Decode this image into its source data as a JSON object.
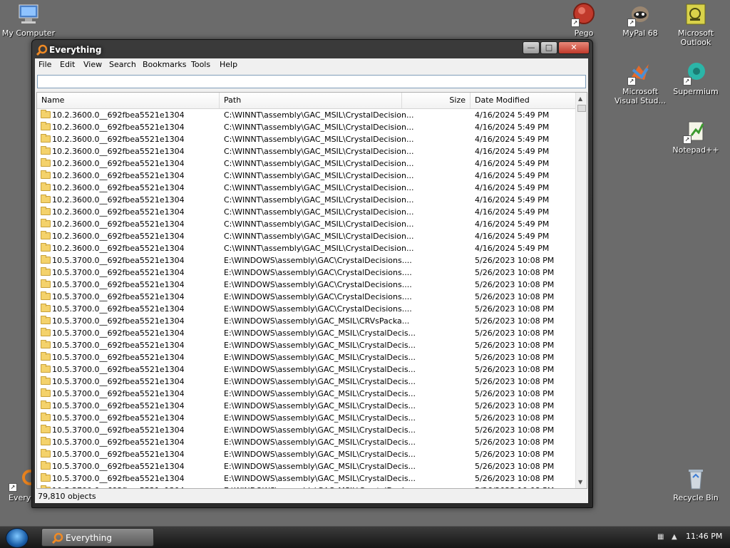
{
  "desktop": {
    "icons": [
      {
        "label": "My Computer",
        "icon": "computer-icon"
      },
      {
        "label": "Pego",
        "icon": "pego-icon"
      },
      {
        "label": "MyPal 68",
        "icon": "mypal-icon"
      },
      {
        "label": "Microsoft Outlook",
        "icon": "outlook-icon"
      },
      {
        "label": "Microsoft Visual Stud...",
        "icon": "visual-studio-icon"
      },
      {
        "label": "Supermium",
        "icon": "supermium-icon"
      },
      {
        "label": "Notepad++",
        "icon": "notepadpp-icon"
      },
      {
        "label": "Recycle Bin",
        "icon": "recycle-bin-icon"
      },
      {
        "label": "Everyth",
        "icon": "everything-icon"
      }
    ]
  },
  "window": {
    "title": "Everything",
    "buttons": {
      "minimize": "—",
      "maximize": "□",
      "close": "✕"
    },
    "menu": [
      "File",
      "Edit",
      "View",
      "Search",
      "Bookmarks",
      "Tools",
      "Help"
    ],
    "search": {
      "value": "",
      "placeholder": ""
    },
    "columns": [
      "Name",
      "Path",
      "Size",
      "Date Modified"
    ],
    "rows": [
      {
        "name": "10.2.3600.0__692fbea5521e1304",
        "path": "C:\\WINNT\\assembly\\GAC_MSIL\\CrystalDecision...",
        "size": "",
        "date": "4/16/2024 5:49 PM"
      },
      {
        "name": "10.2.3600.0__692fbea5521e1304",
        "path": "C:\\WINNT\\assembly\\GAC_MSIL\\CrystalDecision...",
        "size": "",
        "date": "4/16/2024 5:49 PM"
      },
      {
        "name": "10.2.3600.0__692fbea5521e1304",
        "path": "C:\\WINNT\\assembly\\GAC_MSIL\\CrystalDecision...",
        "size": "",
        "date": "4/16/2024 5:49 PM"
      },
      {
        "name": "10.2.3600.0__692fbea5521e1304",
        "path": "C:\\WINNT\\assembly\\GAC_MSIL\\CrystalDecision...",
        "size": "",
        "date": "4/16/2024 5:49 PM"
      },
      {
        "name": "10.2.3600.0__692fbea5521e1304",
        "path": "C:\\WINNT\\assembly\\GAC_MSIL\\CrystalDecision...",
        "size": "",
        "date": "4/16/2024 5:49 PM"
      },
      {
        "name": "10.2.3600.0__692fbea5521e1304",
        "path": "C:\\WINNT\\assembly\\GAC_MSIL\\CrystalDecision...",
        "size": "",
        "date": "4/16/2024 5:49 PM"
      },
      {
        "name": "10.2.3600.0__692fbea5521e1304",
        "path": "C:\\WINNT\\assembly\\GAC_MSIL\\CrystalDecision...",
        "size": "",
        "date": "4/16/2024 5:49 PM"
      },
      {
        "name": "10.2.3600.0__692fbea5521e1304",
        "path": "C:\\WINNT\\assembly\\GAC_MSIL\\CrystalDecision...",
        "size": "",
        "date": "4/16/2024 5:49 PM"
      },
      {
        "name": "10.2.3600.0__692fbea5521e1304",
        "path": "C:\\WINNT\\assembly\\GAC_MSIL\\CrystalDecision...",
        "size": "",
        "date": "4/16/2024 5:49 PM"
      },
      {
        "name": "10.2.3600.0__692fbea5521e1304",
        "path": "C:\\WINNT\\assembly\\GAC_MSIL\\CrystalDecision...",
        "size": "",
        "date": "4/16/2024 5:49 PM"
      },
      {
        "name": "10.2.3600.0__692fbea5521e1304",
        "path": "C:\\WINNT\\assembly\\GAC_MSIL\\CrystalDecision...",
        "size": "",
        "date": "4/16/2024 5:49 PM"
      },
      {
        "name": "10.2.3600.0__692fbea5521e1304",
        "path": "C:\\WINNT\\assembly\\GAC_MSIL\\CrystalDecision...",
        "size": "",
        "date": "4/16/2024 5:49 PM"
      },
      {
        "name": "10.5.3700.0__692fbea5521e1304",
        "path": "E:\\WINDOWS\\assembly\\GAC\\CrystalDecisions....",
        "size": "",
        "date": "5/26/2023 10:08 PM"
      },
      {
        "name": "10.5.3700.0__692fbea5521e1304",
        "path": "E:\\WINDOWS\\assembly\\GAC\\CrystalDecisions....",
        "size": "",
        "date": "5/26/2023 10:08 PM"
      },
      {
        "name": "10.5.3700.0__692fbea5521e1304",
        "path": "E:\\WINDOWS\\assembly\\GAC\\CrystalDecisions....",
        "size": "",
        "date": "5/26/2023 10:08 PM"
      },
      {
        "name": "10.5.3700.0__692fbea5521e1304",
        "path": "E:\\WINDOWS\\assembly\\GAC\\CrystalDecisions....",
        "size": "",
        "date": "5/26/2023 10:08 PM"
      },
      {
        "name": "10.5.3700.0__692fbea5521e1304",
        "path": "E:\\WINDOWS\\assembly\\GAC\\CrystalDecisions....",
        "size": "",
        "date": "5/26/2023 10:08 PM"
      },
      {
        "name": "10.5.3700.0__692fbea5521e1304",
        "path": "E:\\WINDOWS\\assembly\\GAC_MSIL\\CRVsPacka...",
        "size": "",
        "date": "5/26/2023 10:08 PM"
      },
      {
        "name": "10.5.3700.0__692fbea5521e1304",
        "path": "E:\\WINDOWS\\assembly\\GAC_MSIL\\CrystalDecis...",
        "size": "",
        "date": "5/26/2023 10:08 PM"
      },
      {
        "name": "10.5.3700.0__692fbea5521e1304",
        "path": "E:\\WINDOWS\\assembly\\GAC_MSIL\\CrystalDecis...",
        "size": "",
        "date": "5/26/2023 10:08 PM"
      },
      {
        "name": "10.5.3700.0__692fbea5521e1304",
        "path": "E:\\WINDOWS\\assembly\\GAC_MSIL\\CrystalDecis...",
        "size": "",
        "date": "5/26/2023 10:08 PM"
      },
      {
        "name": "10.5.3700.0__692fbea5521e1304",
        "path": "E:\\WINDOWS\\assembly\\GAC_MSIL\\CrystalDecis...",
        "size": "",
        "date": "5/26/2023 10:08 PM"
      },
      {
        "name": "10.5.3700.0__692fbea5521e1304",
        "path": "E:\\WINDOWS\\assembly\\GAC_MSIL\\CrystalDecis...",
        "size": "",
        "date": "5/26/2023 10:08 PM"
      },
      {
        "name": "10.5.3700.0__692fbea5521e1304",
        "path": "E:\\WINDOWS\\assembly\\GAC_MSIL\\CrystalDecis...",
        "size": "",
        "date": "5/26/2023 10:08 PM"
      },
      {
        "name": "10.5.3700.0__692fbea5521e1304",
        "path": "E:\\WINDOWS\\assembly\\GAC_MSIL\\CrystalDecis...",
        "size": "",
        "date": "5/26/2023 10:08 PM"
      },
      {
        "name": "10.5.3700.0__692fbea5521e1304",
        "path": "E:\\WINDOWS\\assembly\\GAC_MSIL\\CrystalDecis...",
        "size": "",
        "date": "5/26/2023 10:08 PM"
      },
      {
        "name": "10.5.3700.0__692fbea5521e1304",
        "path": "E:\\WINDOWS\\assembly\\GAC_MSIL\\CrystalDecis...",
        "size": "",
        "date": "5/26/2023 10:08 PM"
      },
      {
        "name": "10.5.3700.0__692fbea5521e1304",
        "path": "E:\\WINDOWS\\assembly\\GAC_MSIL\\CrystalDecis...",
        "size": "",
        "date": "5/26/2023 10:08 PM"
      },
      {
        "name": "10.5.3700.0__692fbea5521e1304",
        "path": "E:\\WINDOWS\\assembly\\GAC_MSIL\\CrystalDecis...",
        "size": "",
        "date": "5/26/2023 10:08 PM"
      },
      {
        "name": "10.5.3700.0__692fbea5521e1304",
        "path": "E:\\WINDOWS\\assembly\\GAC_MSIL\\CrystalDecis...",
        "size": "",
        "date": "5/26/2023 10:08 PM"
      },
      {
        "name": "10.5.3700.0__692fbea5521e1304",
        "path": "E:\\WINDOWS\\assembly\\GAC_MSIL\\CrystalDecis...",
        "size": "",
        "date": "5/26/2023 10:08 PM"
      },
      {
        "name": "10.5.3700.0__692fbea5521e1304",
        "path": "E:\\WINDOWS\\assembly\\GAC_MSIL\\CrystalDecis...",
        "size": "",
        "date": "5/26/2023 10:08 PM"
      }
    ],
    "status": "79,810 objects"
  },
  "taskbar": {
    "start_icon": "windows-orb-icon",
    "task_button_label": "Everything",
    "clock": "11:46 PM"
  },
  "colors": {
    "desktop": "#6b6b6b",
    "folder": "#f4d26b",
    "close_button": "#c0392b"
  }
}
